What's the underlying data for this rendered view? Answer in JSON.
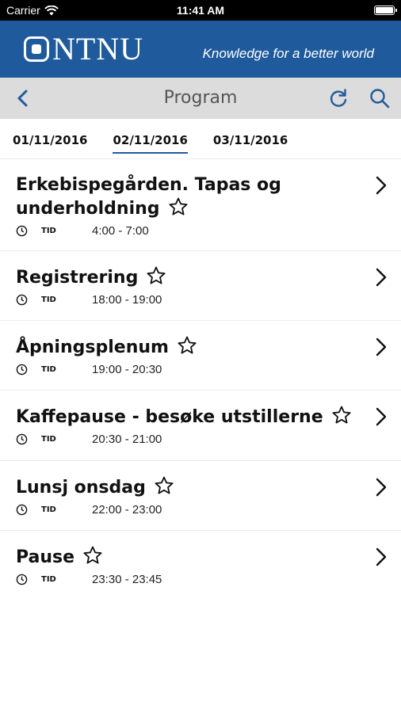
{
  "status_bar": {
    "carrier": "Carrier",
    "time": "11:41 AM"
  },
  "brand": {
    "logo_text": "NTNU",
    "tagline": "Knowledge for a better world",
    "color": "#1f5b9c"
  },
  "navbar": {
    "title": "Program"
  },
  "tabs": [
    {
      "label": "01/11/2016",
      "active": false
    },
    {
      "label": "02/11/2016",
      "active": true
    },
    {
      "label": "03/11/2016",
      "active": false
    }
  ],
  "items": [
    {
      "title": "Erkebispegården. Tapas og underholdning",
      "tid_label": "TID",
      "time": "4:00 - 7:00"
    },
    {
      "title": "Registrering",
      "tid_label": "TID",
      "time": "18:00 - 19:00"
    },
    {
      "title": "Åpningsplenum",
      "tid_label": "TID",
      "time": "19:00 - 20:30"
    },
    {
      "title": "Kaffepause - besøke utstillerne",
      "tid_label": "TID",
      "time": "20:30 - 21:00"
    },
    {
      "title": "Lunsj onsdag",
      "tid_label": "TID",
      "time": "22:00 - 23:00"
    },
    {
      "title": "Pause",
      "tid_label": "TID",
      "time": "23:30 - 23:45"
    }
  ]
}
